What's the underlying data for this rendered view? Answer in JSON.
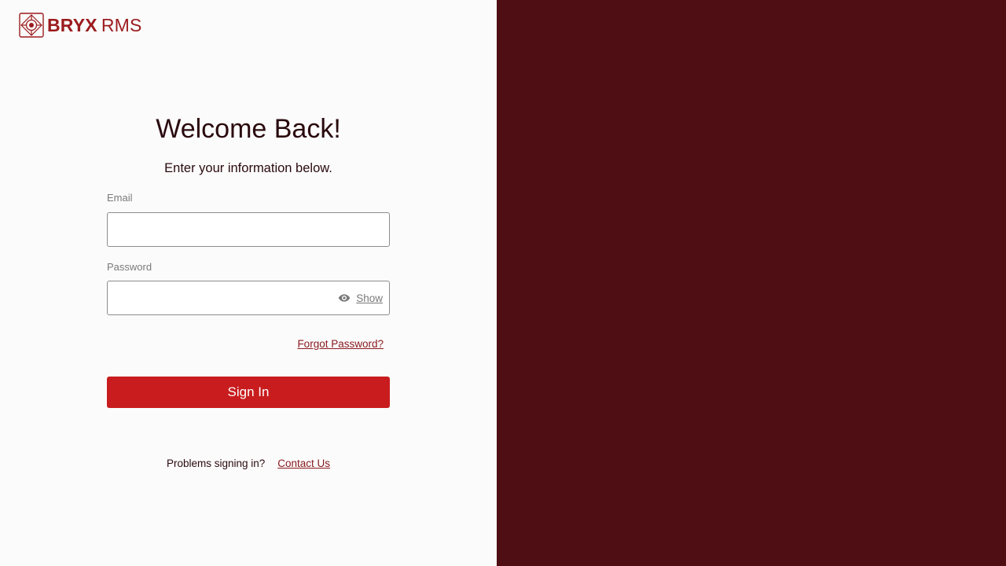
{
  "brand": {
    "name_bold": "BRYX",
    "name_light": "RMS",
    "logo_icon": "bryx-crosshair-logo",
    "color": "#9b1b1e"
  },
  "login": {
    "title": "Welcome Back!",
    "subtitle": "Enter your information below.",
    "email": {
      "label": "Email",
      "value": "",
      "placeholder": ""
    },
    "password": {
      "label": "Password",
      "value": "",
      "placeholder": "",
      "show_label": "Show",
      "show_icon": "eye-icon"
    },
    "forgot_label": "Forgot Password?",
    "signin_label": "Sign In",
    "problems_text": "Problems signing in?",
    "contact_label": "Contact Us"
  },
  "colors": {
    "primary": "#c81c1e",
    "panel": "#4f0e14",
    "link": "#8a1b20",
    "background": "#fbfbfb"
  }
}
